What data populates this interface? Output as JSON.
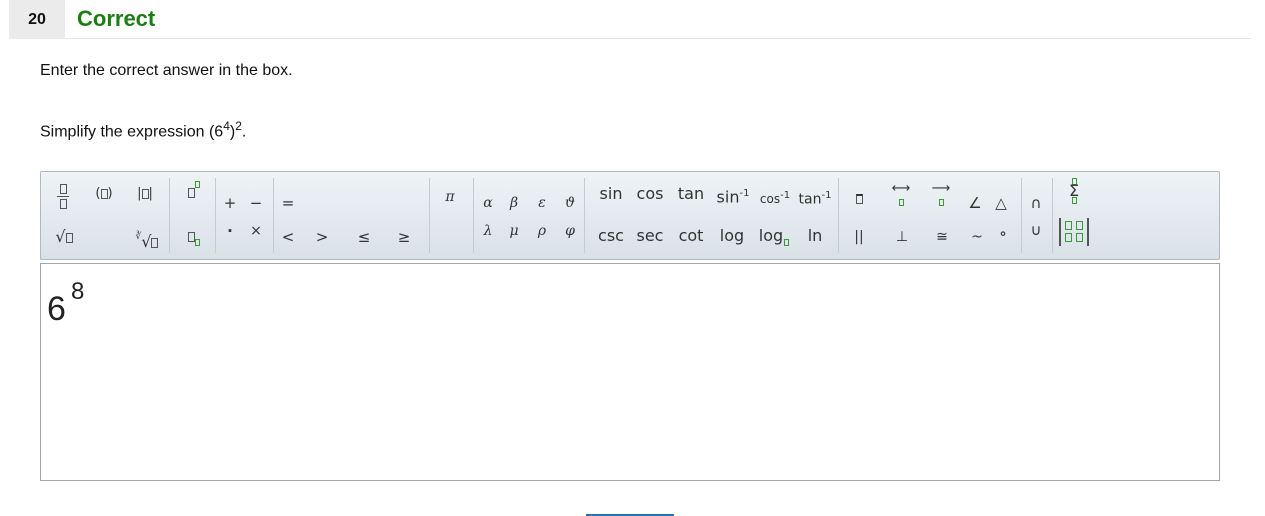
{
  "header": {
    "question_number": "20",
    "status": "Correct"
  },
  "instruction": "Enter the correct answer in the box.",
  "question": {
    "prefix": "Simplify the expression (6",
    "inner_exp": "4",
    "close": ")",
    "outer_exp": "2",
    "suffix": "."
  },
  "toolbar": {
    "relations": [
      "+",
      "−",
      "=",
      "·",
      "×",
      "<",
      ">",
      "≤",
      "≥"
    ],
    "pi": "π",
    "greek": [
      "α",
      "β",
      "ε",
      "ϑ",
      "λ",
      "μ",
      "ρ",
      "φ"
    ],
    "trig_top": [
      "sin",
      "cos",
      "tan",
      "sin",
      "cos",
      "tan"
    ],
    "trig_bottom": [
      "csc",
      "sec",
      "cot",
      "log",
      "log",
      "ln"
    ],
    "inverse_exp": "-1",
    "geometry": [
      "∠",
      "△",
      "∩",
      "∪",
      "||",
      "⊥",
      "≅",
      "~",
      "∘"
    ],
    "sigma": "Σ"
  },
  "answer": {
    "base": "6",
    "exponent": "8"
  },
  "colors": {
    "correct": "#1b7d12",
    "toolbar_border": "#aeb9c4",
    "placeholder_green": "#3a9a3a"
  }
}
